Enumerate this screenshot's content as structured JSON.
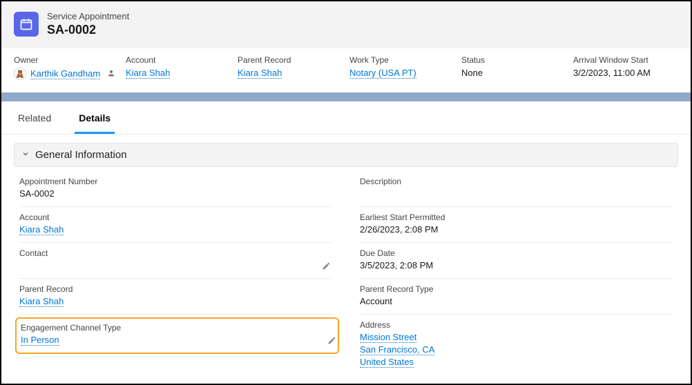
{
  "header": {
    "subtitle": "Service Appointment",
    "title": "SA-0002"
  },
  "summary": {
    "owner": {
      "label": "Owner",
      "value": "Karthik Gandham"
    },
    "account": {
      "label": "Account",
      "value": "Kiara Shah"
    },
    "parent_record": {
      "label": "Parent Record",
      "value": "Kiara Shah"
    },
    "work_type": {
      "label": "Work Type",
      "value": "Notary (USA PT)"
    },
    "status": {
      "label": "Status",
      "value": "None"
    },
    "arrival": {
      "label": "Arrival Window Start",
      "value": "3/2/2023, 11:00 AM"
    }
  },
  "tabs": {
    "related": "Related",
    "details": "Details"
  },
  "section": {
    "title": "General Information"
  },
  "fields_left": {
    "appointment_number": {
      "label": "Appointment Number",
      "value": "SA-0002"
    },
    "account": {
      "label": "Account",
      "value": "Kiara Shah"
    },
    "contact": {
      "label": "Contact",
      "value": ""
    },
    "parent_record": {
      "label": "Parent Record",
      "value": "Kiara Shah"
    },
    "engagement_channel_type": {
      "label": "Engagement Channel Type",
      "value": "In Person"
    }
  },
  "fields_right": {
    "description": {
      "label": "Description",
      "value": ""
    },
    "earliest_start": {
      "label": "Earliest Start Permitted",
      "value": "2/26/2023, 2:08 PM"
    },
    "due_date": {
      "label": "Due Date",
      "value": "3/5/2023, 2:08 PM"
    },
    "parent_record_type": {
      "label": "Parent Record Type",
      "value": "Account"
    },
    "address": {
      "label": "Address",
      "line1": "Mission Street",
      "line2": "San Francisco, CA",
      "line3": "United States"
    }
  }
}
